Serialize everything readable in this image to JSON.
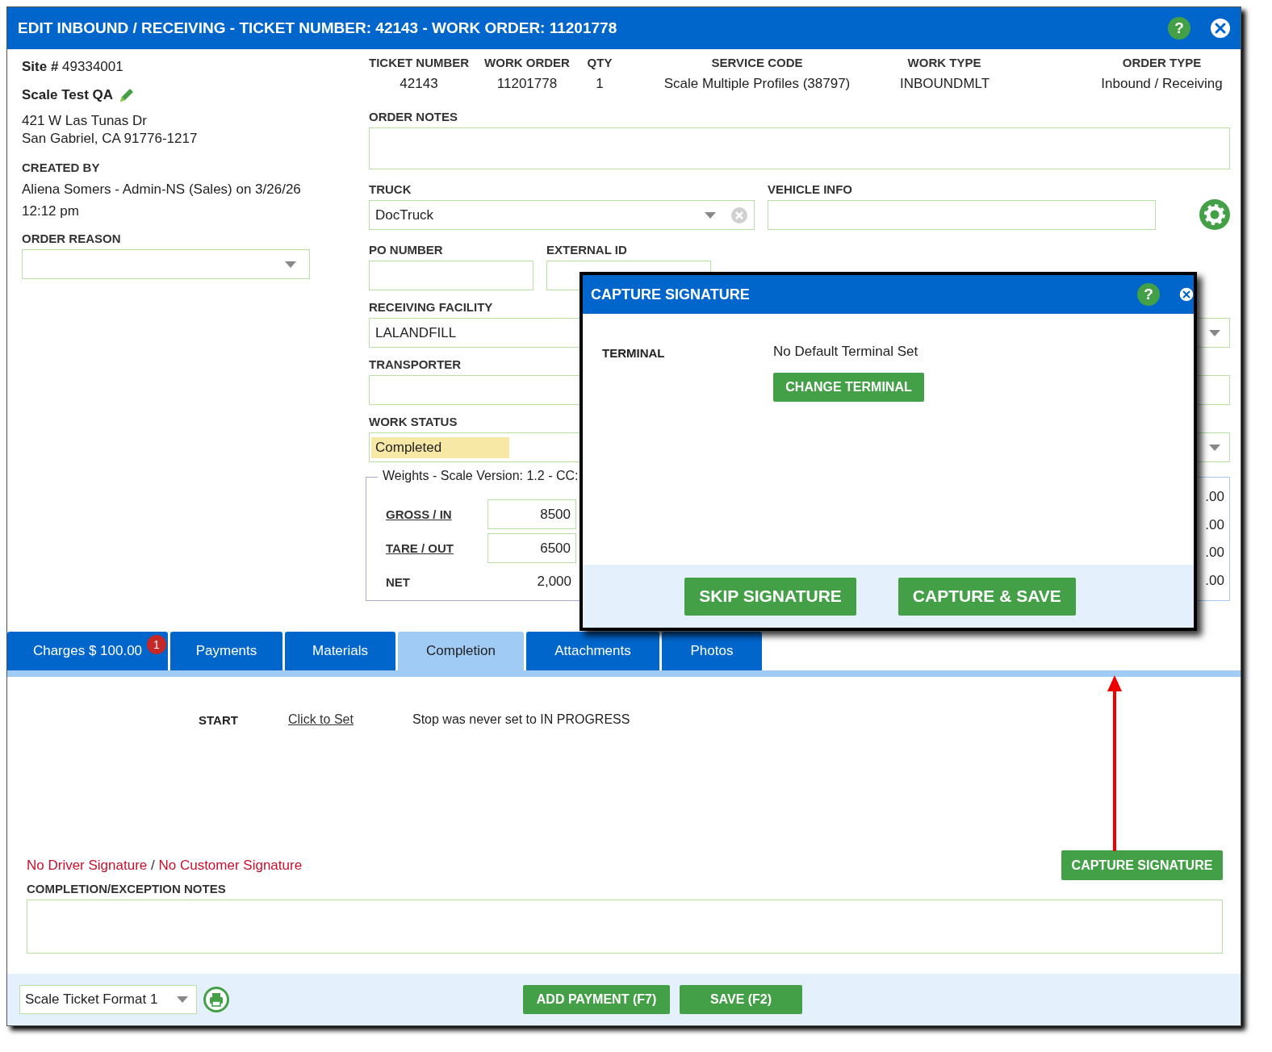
{
  "window": {
    "title": "EDIT INBOUND / RECEIVING - TICKET NUMBER: 42143 - WORK ORDER: 11201778",
    "help": "?"
  },
  "site": {
    "number": "**Site #** 49334001",
    "name": "Scale Test QA",
    "address": [
      "421 W Las Tunas Dr",
      "San Gabriel, CA 91776-1217"
    ]
  },
  "created_by": {
    "label": "CREATED BY",
    "lines": [
      "Aliena Somers - Admin-NS (Sales) on 3/26/26",
      "12:12 pm"
    ]
  },
  "order_reason": {
    "label": "ORDER REASON"
  },
  "summary": [
    {
      "label": "TICKET NUMBER",
      "value": "42143"
    },
    {
      "label": "WORK ORDER",
      "value": "11201778"
    },
    {
      "label": "QTY",
      "value": "1"
    },
    {
      "label": "SERVICE CODE",
      "value": "Scale Multiple Profiles (38797)"
    },
    {
      "label": "WORK TYPE",
      "value": "INBOUNDMLT"
    },
    {
      "label": "ORDER TYPE",
      "value": "Inbound / Receiving"
    }
  ],
  "order_notes": {
    "label": "ORDER NOTES"
  },
  "truck": {
    "label": "TRUCK",
    "value": "DocTruck"
  },
  "vehicle_info": {
    "label": "VEHICLE INFO"
  },
  "po_number": {
    "label": "PO NUMBER"
  },
  "external_id": {
    "label": "EXTERNAL ID"
  },
  "receiving_facility": {
    "label": "RECEIVING FACILITY",
    "value": "LALANDFILL"
  },
  "transporter": {
    "label": "TRANSPORTER"
  },
  "work_status": {
    "label": "WORK STATUS",
    "value": "Completed"
  },
  "weights": {
    "legend": "Weights - Scale Version: 1.2 - CC:",
    "rows": [
      {
        "label": "GROSS / IN",
        "value": "8500",
        "kind": "input"
      },
      {
        "label": "TARE / OUT",
        "value": "6500",
        "kind": "input"
      },
      {
        "label": "NET",
        "value": "2,000",
        "kind": "text"
      }
    ]
  },
  "totals_partial": [
    ".00",
    ".00",
    ".00",
    ".00"
  ],
  "tabs": [
    {
      "label": "Charges $ 100.00",
      "badge": "1",
      "selected": false
    },
    {
      "label": "Payments",
      "selected": false
    },
    {
      "label": "Materials",
      "selected": false
    },
    {
      "label": "Completion",
      "selected": true
    },
    {
      "label": "Attachments",
      "selected": false
    },
    {
      "label": "Photos",
      "selected": false
    }
  ],
  "completion": {
    "start_label": "START",
    "start_link": "Click to Set",
    "start_message": "Stop was never set to IN PROGRESS",
    "signature_status": {
      "driver": "No Driver Signature",
      "separator": "/",
      "customer": "No Customer Signature"
    },
    "capture_button": "CAPTURE SIGNATURE",
    "notes_label": "COMPLETION/EXCEPTION NOTES"
  },
  "footer": {
    "format_select": "Scale Ticket Format 1",
    "buttons": [
      "ADD PAYMENT (F7)",
      "SAVE (F2)"
    ]
  },
  "modal": {
    "title": "CAPTURE SIGNATURE",
    "help": "?",
    "terminal_label": "TERMINAL",
    "terminal_value": "No Default Terminal Set",
    "change_button": "CHANGE TERMINAL",
    "buttons": [
      "SKIP SIGNATURE",
      "CAPTURE & SAVE"
    ]
  }
}
